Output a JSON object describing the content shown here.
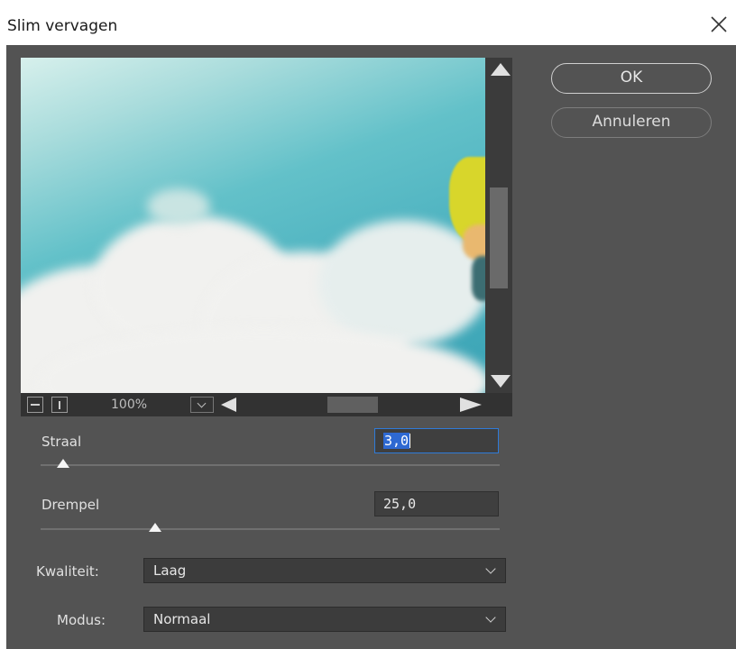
{
  "window": {
    "title": "Slim vervagen"
  },
  "preview": {
    "zoom": "100%"
  },
  "buttons": {
    "ok": "OK",
    "cancel": "Annuleren"
  },
  "controls": {
    "radius": {
      "label": "Straal",
      "value": "3,0",
      "slider_fraction": 0.05
    },
    "threshold": {
      "label": "Drempel",
      "value": "25,0",
      "slider_fraction": 0.25
    },
    "quality": {
      "label": "Kwaliteit:",
      "selected": "Laag"
    },
    "mode": {
      "label": "Modus:",
      "selected": "Normaal"
    }
  },
  "colors": {
    "dialog_bg": "#535353",
    "focus_accent": "#2f7bd8"
  }
}
